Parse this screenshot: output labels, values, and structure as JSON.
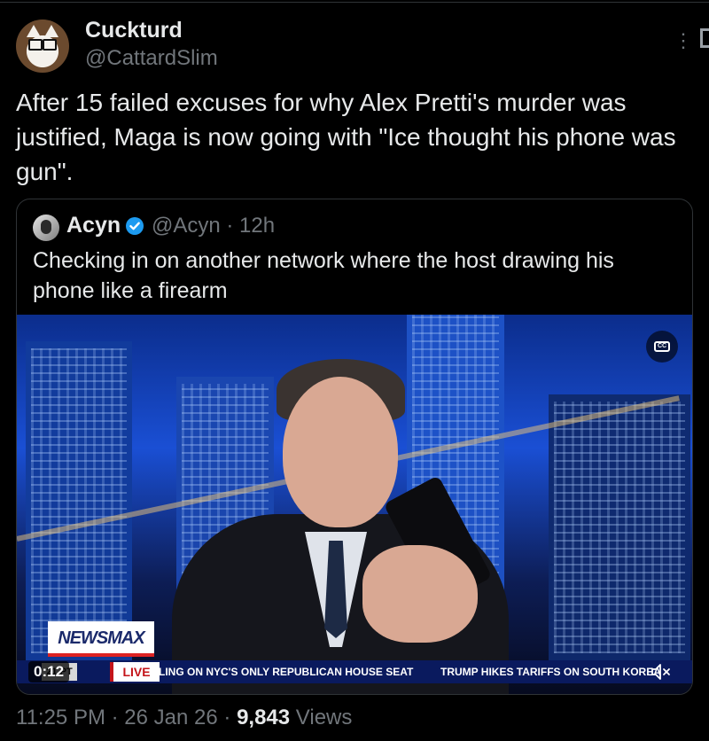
{
  "author": {
    "display_name": "Cuckturd",
    "handle": "@CattardSlim",
    "avatar": "cat-with-glasses-avatar"
  },
  "tweet": {
    "text": "After 15 failed excuses for why Alex Pretti's murder was justified, Maga is now going with \"Ice thought his phone was gun\"."
  },
  "quote": {
    "display_name": "Acyn",
    "verified": true,
    "handle_time": "@Acyn · 12h",
    "text": "Checking in on another network where the host drawing his phone like a firearm",
    "video": {
      "elapsed": "0:12",
      "cc_label": "CC",
      "logo_text": "NEWSMAX",
      "time_chip": "21 PT",
      "live_label": "LIVE",
      "ticker_1": "LING ON NYC'S ONLY REPUBLICAN HOUSE SEAT",
      "ticker_2": "TRUMP HIKES TARIFFS ON SOUTH KOREA",
      "muted": true
    }
  },
  "meta": {
    "time": "11:25 PM",
    "date": "26 Jan 26",
    "views_count": "9,843",
    "views_label": "Views"
  },
  "colors": {
    "background": "#000000",
    "text": "#e7e9ea",
    "muted": "#71767b",
    "verified": "#1d9bf0",
    "border": "#2f3336"
  }
}
